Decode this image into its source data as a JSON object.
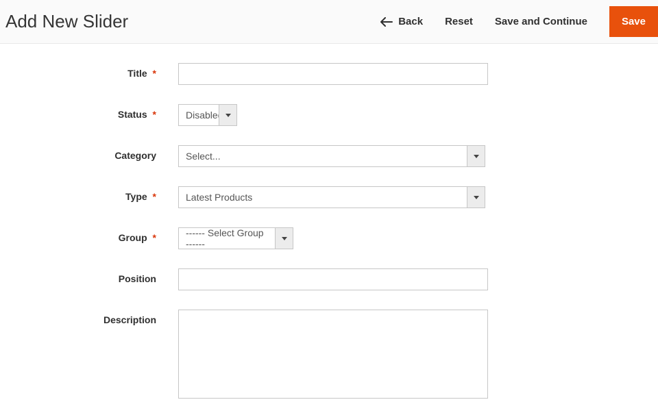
{
  "header": {
    "title": "Add New Slider",
    "back": "Back",
    "reset": "Reset",
    "save_continue": "Save and Continue",
    "save": "Save"
  },
  "form": {
    "title": {
      "label": "Title",
      "required": true,
      "value": ""
    },
    "status": {
      "label": "Status",
      "required": true,
      "value": "Disabled"
    },
    "category": {
      "label": "Category",
      "required": false,
      "value": "Select..."
    },
    "type": {
      "label": "Type",
      "required": true,
      "value": "Latest Products"
    },
    "group": {
      "label": "Group",
      "required": true,
      "value": "------ Select Group ------"
    },
    "position": {
      "label": "Position",
      "required": false,
      "value": ""
    },
    "description": {
      "label": "Description",
      "required": false,
      "value": ""
    }
  }
}
